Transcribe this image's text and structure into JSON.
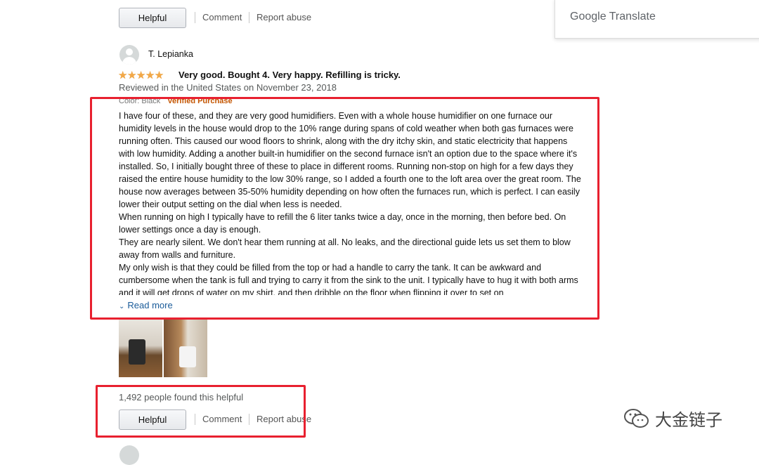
{
  "translate": {
    "label": "Google Translate"
  },
  "prev_review": {
    "helpful_button": "Helpful",
    "comment": "Comment",
    "report": "Report abuse"
  },
  "review": {
    "reviewer": "T. Lepianka",
    "rating": 5,
    "stars_text": "★★★★★",
    "title": "Very good. Bought 4. Very happy. Refilling is tricky.",
    "date": "Reviewed in the United States on November 23, 2018",
    "color": "Color: Black",
    "verified": "Verified Purchase",
    "body": [
      "I have four of these, and they are very good humidifiers. Even with a whole house humidifier on one furnace our humidity levels in the house would drop to the 10% range during spans of cold weather when both gas furnaces were running often. This caused our wood floors to shrink, along with the dry itchy skin, and static electricity that happens with low humidity. Adding a another built-in humidifier on the second furnace isn't an option due to the space where it's installed. So, I initially bought three of these to place in different rooms. Running non-stop on high for a few days they raised the entire house humidity to the low 30% range, so I added a fourth one to the loft area over the great room. The house now averages between 35-50% humidity depending on how often the furnaces run, which is perfect. I can easily lower their output setting on the dial when less is needed.",
      "When running on high I typically have to refill the 6 liter tanks twice a day, once in the morning, then before bed. On lower settings once a day is enough.",
      "They are nearly silent. We don't hear them running at all. No leaks, and the directional guide lets us set them to blow away from walls and furniture.",
      "My only wish is that they could be filled from the top or had a handle to carry the tank. It can be awkward and cumbersome when the tank is full and trying to carry it from the sink to the unit. I typically have to hug it with both arms and it will get drops of water on my shirt, and then dribble on the floor when flipping it over to set on"
    ],
    "read_more": "Read more",
    "helpful_count": "1,492 people found this helpful",
    "helpful_button": "Helpful",
    "comment": "Comment",
    "report": "Report abuse"
  },
  "watermark": {
    "text": "大金链子"
  },
  "colors": {
    "highlight": "#e8202f",
    "star": "#f3a847",
    "link": "#1a5b99",
    "verified": "#c45500"
  }
}
